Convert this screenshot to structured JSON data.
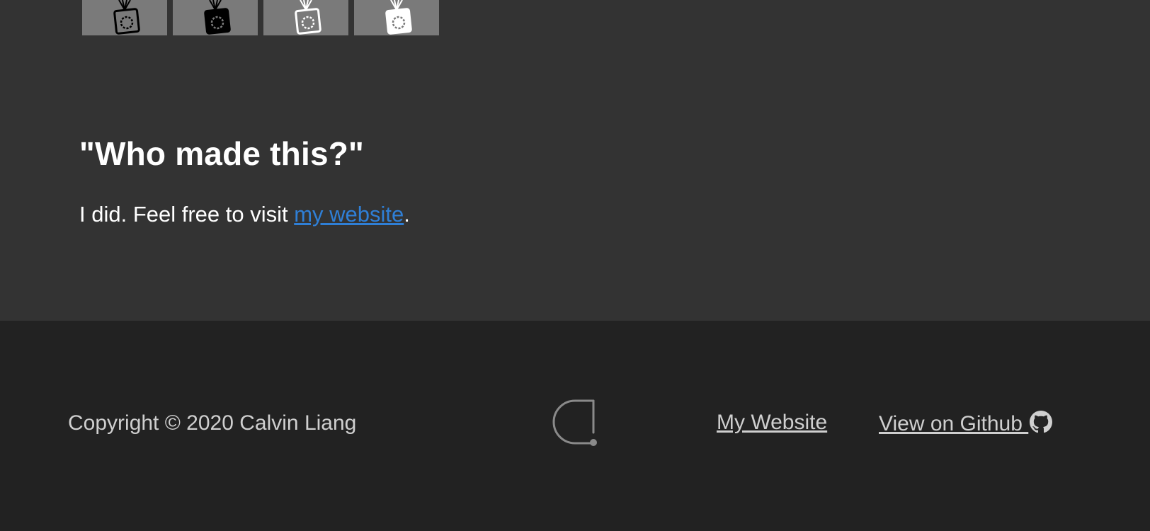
{
  "main": {
    "thumbnails": [
      {
        "icon": "camera-icon",
        "variant": "outline-dark"
      },
      {
        "icon": "camera-icon",
        "variant": "filled-dark"
      },
      {
        "icon": "camera-icon",
        "variant": "outline-light"
      },
      {
        "icon": "camera-icon",
        "variant": "filled-light"
      }
    ],
    "heading": "\"Who made this?\"",
    "paragraph_prefix": "I did. Feel free to visit ",
    "paragraph_link": "my website",
    "paragraph_suffix": "."
  },
  "footer": {
    "copyright": "Copyright © 2020 Calvin Liang",
    "logo_icon": "cl-logo-icon",
    "links": {
      "website": "My Website",
      "github": "View on Github "
    },
    "github_icon": "github-icon"
  },
  "colors": {
    "main_bg": "#333333",
    "footer_bg": "#222222",
    "link": "#2f7fd6",
    "footer_text": "#cfcfcf"
  }
}
